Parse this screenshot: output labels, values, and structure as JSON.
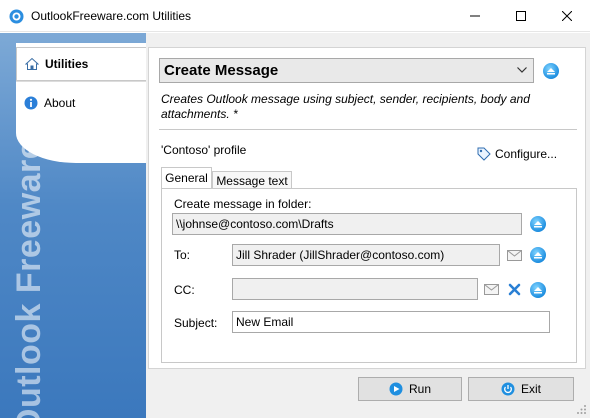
{
  "window": {
    "title": "OutlookFreeware.com Utilities",
    "minimize_icon": "minimize-icon",
    "maximize_icon": "maximize-icon",
    "close_icon": "close-icon"
  },
  "sidebar": {
    "brand": "Outlook Freeware .com",
    "items": [
      {
        "label": "Utilities",
        "icon": "home-icon",
        "active": true
      },
      {
        "label": "About",
        "icon": "info-icon",
        "active": false
      }
    ]
  },
  "action": {
    "selected": "Create Message",
    "description": "Creates Outlook message using subject, sender, recipients, body and attachments. *"
  },
  "profile": {
    "label": "'Contoso' profile",
    "configure_label": "Configure..."
  },
  "tabs": [
    {
      "label": "General",
      "active": true
    },
    {
      "label": "Message text",
      "active": false
    }
  ],
  "general": {
    "folder_label": "Create message in folder:",
    "folder_value": "\\\\johnse@contoso.com\\Drafts",
    "to_label": "To:",
    "to_value": "Jill Shrader (JillShrader@contoso.com)",
    "cc_label": "CC:",
    "cc_value": "",
    "subject_label": "Subject:",
    "subject_value": "New Email"
  },
  "buttons": {
    "run_label": "Run",
    "exit_label": "Exit"
  },
  "colors": {
    "accent": "#1f8fe0",
    "sidebar_top": "#7da9d6",
    "sidebar_bottom": "#3b78bd",
    "delete": "#2a7fd4"
  }
}
